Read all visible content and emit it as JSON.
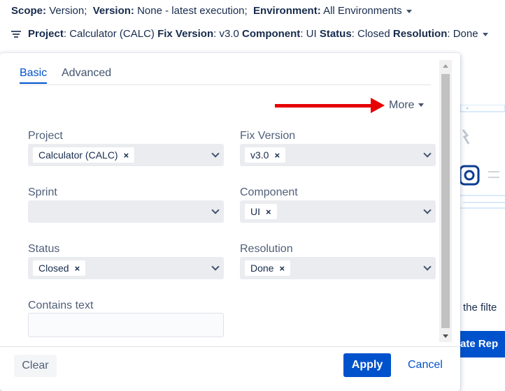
{
  "header": {
    "scope_label": "Scope:",
    "scope_value": "Version;",
    "version_label": "Version:",
    "version_value": "None - latest execution;",
    "environment_label": "Environment:",
    "environment_value": "All Environments"
  },
  "filter_summary": {
    "project_label": "Project",
    "project_value": ": Calculator (CALC)",
    "fix_version_label": "Fix Version",
    "fix_version_value": ": v3.0",
    "component_label": "Component",
    "component_value": ": UI",
    "status_label": "Status",
    "status_value": ": Closed",
    "resolution_label": "Resolution",
    "resolution_value": ": Done"
  },
  "dialog": {
    "tabs": [
      {
        "label": "Basic"
      },
      {
        "label": "Advanced"
      }
    ],
    "more_label": "More",
    "fields": {
      "project": {
        "label": "Project",
        "chip": "Calculator (CALC)"
      },
      "fix_version": {
        "label": "Fix Version",
        "chip": "v3.0"
      },
      "sprint": {
        "label": "Sprint"
      },
      "component": {
        "label": "Component",
        "chip": "UI"
      },
      "status": {
        "label": "Status",
        "chip": "Closed"
      },
      "resolution": {
        "label": "Resolution",
        "chip": "Done"
      },
      "contains_text": {
        "label": "Contains text",
        "value": ""
      }
    },
    "chip_remove": "×",
    "buttons": {
      "clear": "Clear",
      "apply": "Apply",
      "cancel": "Cancel"
    }
  },
  "background": {
    "text": "the filte",
    "button": "ate Rep"
  },
  "colors": {
    "accent": "#0052cc",
    "annotation_arrow": "#e60000",
    "field_bg": "#ebecf0"
  }
}
